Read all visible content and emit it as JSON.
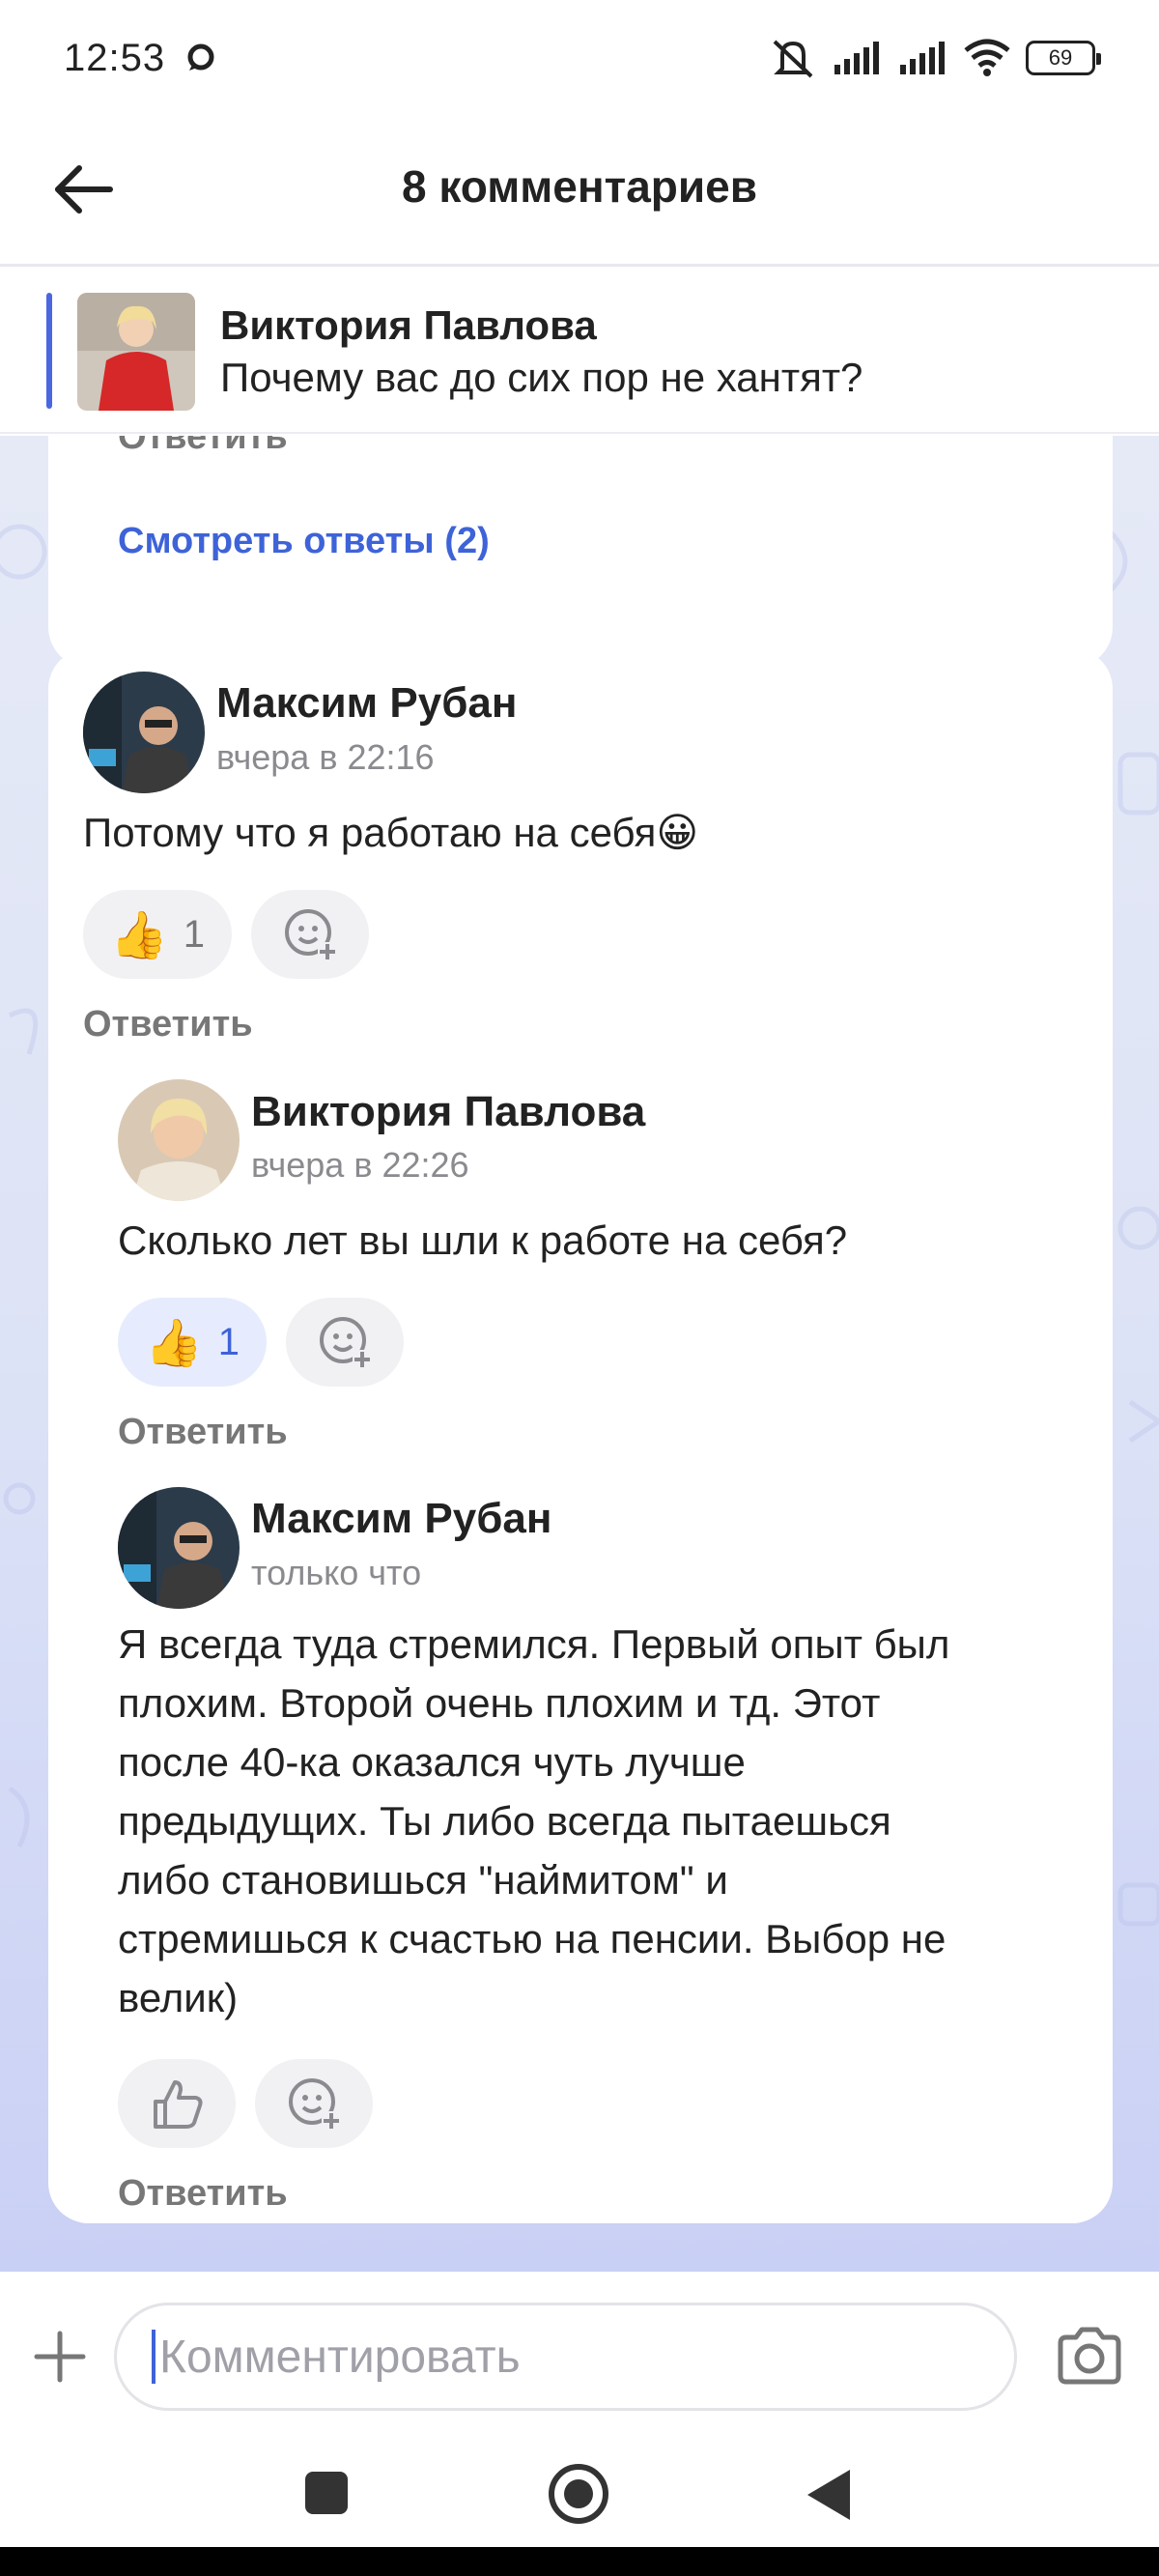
{
  "status_bar": {
    "time": "12:53",
    "battery": "69",
    "icons": [
      "chat-bubble-icon",
      "mute-icon",
      "signal-icon",
      "signal-icon",
      "wifi-icon",
      "battery-icon"
    ]
  },
  "header": {
    "title": "8 комментариев",
    "back_icon": "arrow-left-icon"
  },
  "pinned_post": {
    "author": "Виктория Павлова",
    "text": "Почему вас до сих пор не хантят?"
  },
  "previous_card": {
    "reply_label": "Ответить",
    "see_answers": "Смотреть ответы (2)"
  },
  "thread": {
    "root": {
      "author": "Максим Рубан",
      "time": "вчера в 22:16",
      "text": "Потому что я работаю на себя😀",
      "like_count": "1",
      "reply_label": "Ответить"
    },
    "replies": [
      {
        "author": "Виктория Павлова",
        "time": "вчера в 22:26",
        "text": "Сколько лет вы шли к работе на себя?",
        "like_count": "1",
        "reply_label": "Ответить"
      },
      {
        "author": "Максим Рубан",
        "time": "только что",
        "text_lines": [
          "Я всегда туда стремился. Первый опыт был",
          "плохим. Второй очень плохим и тд. Этот",
          "после 40-ка оказался чуть лучше",
          "предыдущих. Ты либо всегда пытаешься",
          "либо становишься \"наймитом\" и",
          "стремишься к счастью на пенсии. Выбор не",
          "велик)"
        ],
        "reply_label": "Ответить"
      }
    ]
  },
  "composer": {
    "placeholder": "Комментировать"
  },
  "colors": {
    "accent": "#3e63d8",
    "feed_bg": "#dde3f6"
  }
}
